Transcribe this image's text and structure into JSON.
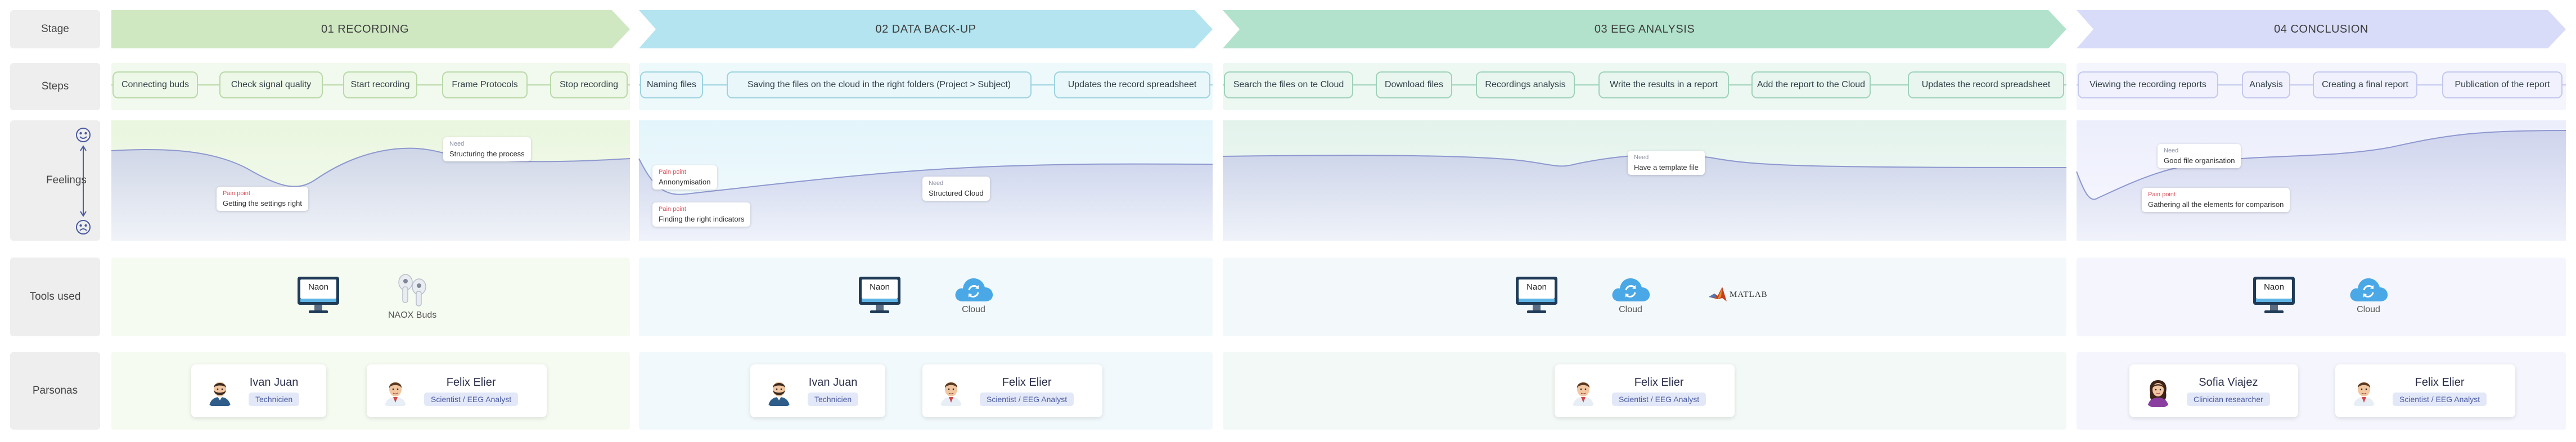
{
  "rows": {
    "stage": "Stage",
    "steps": "Steps",
    "feelings": "Feelings",
    "tools": "Tools used",
    "personas": "Parsonas"
  },
  "stages": [
    {
      "title": "01 RECORDING",
      "color": "#cfe8c2"
    },
    {
      "title": "02 DATA BACK-UP",
      "color": "#b3e4ef"
    },
    {
      "title": "03 EEG ANALYSIS",
      "color": "#b2e2cc"
    },
    {
      "title": "04 CONCLUSION",
      "color": "#d8dcf8"
    }
  ],
  "steps": {
    "recording": [
      "Connecting buds",
      "Check signal quality",
      "Start recording",
      "Frame Protocols",
      "Stop recording"
    ],
    "backup": [
      "Naming files",
      "Saving the files on the cloud in the right folders (Project > Subject)",
      "Updates the record spreadsheet"
    ],
    "analysis": [
      "Search the files on te Cloud",
      "Download files",
      "Recordings analysis",
      "Write the results in a report",
      "Add the report to the Cloud",
      "Updates the record spreadsheet"
    ],
    "conclusion": [
      "Viewing the recording reports",
      "Analysis",
      "Creating a final report",
      "Publication of the report"
    ]
  },
  "feelings": {
    "happy_icon": "smiley-face-icon",
    "sad_icon": "sad-face-icon",
    "notes": [
      {
        "kind": "Pain point",
        "text": "Getting the settings right"
      },
      {
        "kind": "Need",
        "text": "Structuring the process"
      },
      {
        "kind": "Pain point",
        "text": "Annonymisation"
      },
      {
        "kind": "Pain point",
        "text": "Finding the right indicators"
      },
      {
        "kind": "Need",
        "text": "Structured Cloud"
      },
      {
        "kind": "Need",
        "text": "Have a template file"
      },
      {
        "kind": "Need",
        "text": "Good file organisation"
      },
      {
        "kind": "Pain point",
        "text": "Gathering all the elements for comparison"
      }
    ]
  },
  "tools": {
    "naon": "Naon",
    "buds": "NAOX Buds",
    "cloud": "Cloud",
    "matlab": "MATLAB"
  },
  "personas": {
    "ivan": {
      "name": "Ivan Juan",
      "role": "Technicien"
    },
    "felix": {
      "name": "Felix Elier",
      "role": "Scientist / EEG Analyst"
    },
    "sofia": {
      "name": "Sofia Viajez",
      "role": "Clinician researcher"
    }
  }
}
